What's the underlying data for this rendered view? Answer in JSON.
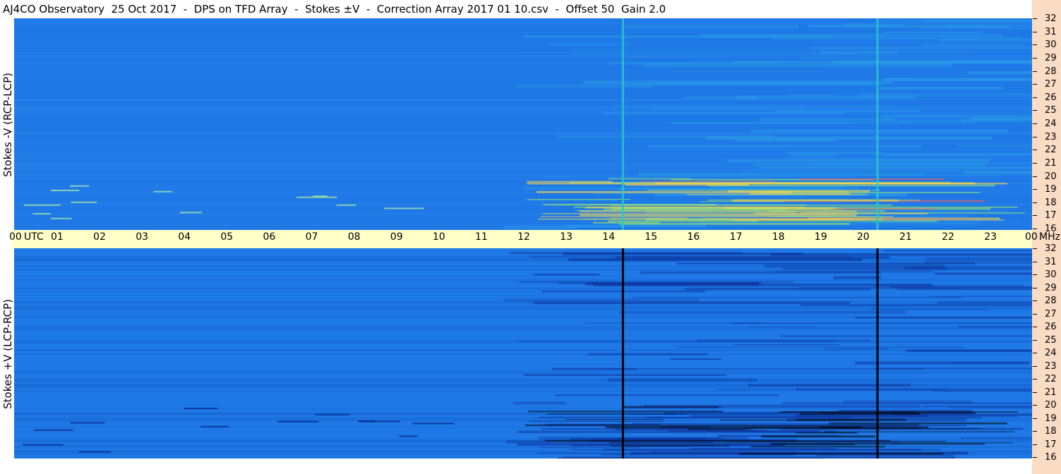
{
  "title": "AJ4CO Observatory  25 Oct 2017  -  DPS on TFD Array  -  Stokes ±V  -  Correction Array 2017 01 10.csv  -  Offset 50  Gain 2.0",
  "chart_data": [
    {
      "type": "heatmap",
      "panel": "top",
      "ylabel": "Stokes -V (RCP-LCP)",
      "x_unit": "UTC",
      "y_unit": "MHz",
      "xlim": [
        0,
        24
      ],
      "ylim": [
        16,
        32
      ],
      "x_ticks": [
        "00",
        "01",
        "02",
        "03",
        "04",
        "05",
        "06",
        "07",
        "08",
        "09",
        "10",
        "11",
        "12",
        "13",
        "14",
        "15",
        "16",
        "17",
        "18",
        "19",
        "20",
        "21",
        "22",
        "23",
        "00"
      ],
      "y_ticks": [
        "16",
        "17",
        "18",
        "19",
        "20",
        "21",
        "22",
        "23",
        "24",
        "25",
        "26",
        "27",
        "28",
        "29",
        "30",
        "31",
        "32"
      ],
      "colors": {
        "background": "#1e78e6",
        "enhanced": "#2aa0e6",
        "bright": "#9ae66e",
        "peak": "#ff5a5a",
        "vertical_line": "#28c8c8"
      },
      "vertical_lines_utc": [
        14.35,
        20.35
      ],
      "features": [
        {
          "name": "enhanced noise",
          "utc_range": [
            11.5,
            24
          ],
          "mhz_range": [
            16,
            32
          ]
        },
        {
          "name": "bright bands",
          "utc_range": [
            12,
            22.5
          ],
          "mhz_range": [
            16.5,
            20
          ]
        }
      ]
    },
    {
      "type": "heatmap",
      "panel": "bottom",
      "ylabel": "Stokes +V (LCP-RCP)",
      "x_unit": "UTC",
      "y_unit": "MHz",
      "xlim": [
        0,
        24
      ],
      "ylim": [
        16,
        32
      ],
      "y_ticks": [
        "16",
        "17",
        "18",
        "19",
        "20",
        "21",
        "22",
        "23",
        "24",
        "25",
        "26",
        "27",
        "28",
        "29",
        "30",
        "31",
        "32"
      ],
      "colors": {
        "background": "#1e78e6",
        "darkened": "#0c2d96",
        "vertical_line": "#000000"
      },
      "vertical_lines_utc": [
        14.35,
        20.35
      ],
      "features": [
        {
          "name": "darkened noise",
          "utc_range": [
            11.5,
            24
          ],
          "mhz_range": [
            16,
            32
          ]
        },
        {
          "name": "dark bands",
          "utc_range": [
            12,
            22.5
          ],
          "mhz_range": [
            16,
            20
          ]
        }
      ]
    }
  ],
  "time_axis": {
    "labels": [
      "00",
      "UTC",
      "01",
      "02",
      "03",
      "04",
      "05",
      "06",
      "07",
      "08",
      "09",
      "10",
      "11",
      "12",
      "13",
      "14",
      "15",
      "16",
      "17",
      "18",
      "19",
      "20",
      "21",
      "22",
      "23",
      "00",
      "MHz"
    ]
  }
}
